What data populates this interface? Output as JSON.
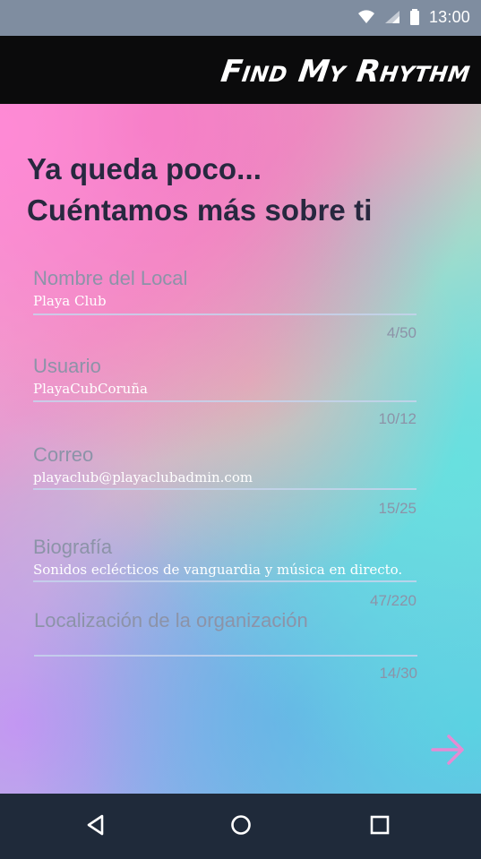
{
  "status_bar": {
    "time": "13:00",
    "icons": [
      "wifi-icon",
      "signal-icon",
      "battery-icon"
    ]
  },
  "app_bar": {
    "title": "Find My Rhythm"
  },
  "form": {
    "heading_line1": "Ya queda poco...",
    "heading_line2": "Cuéntamos más sobre ti",
    "fields": [
      {
        "label": "Nombre del Local",
        "value": "Playa Club",
        "counter": "4/50"
      },
      {
        "label": "Usuario",
        "value": "PlayaCubCoruña",
        "counter": "10/12"
      },
      {
        "label": "Correo",
        "value": "playaclub@playaclubadmin.com",
        "counter": "15/25"
      },
      {
        "label": "Biografía",
        "value": "Sonidos eclécticos de vanguardia y música en directo.",
        "counter": "47/220"
      },
      {
        "label": "Localización de la organización",
        "value": "",
        "counter": "14/30"
      }
    ],
    "next_icon": "arrow-right-icon"
  },
  "nav_bar": {
    "icons": [
      "back-icon",
      "home-icon",
      "recents-icon"
    ]
  },
  "colors": {
    "status_bar": "#7f8da0",
    "app_bar": "#0b0b0c",
    "nav_bar": "#1f2a3a",
    "heading": "#27283f",
    "label": "#8c93a8",
    "accent": "#e58bd3"
  }
}
